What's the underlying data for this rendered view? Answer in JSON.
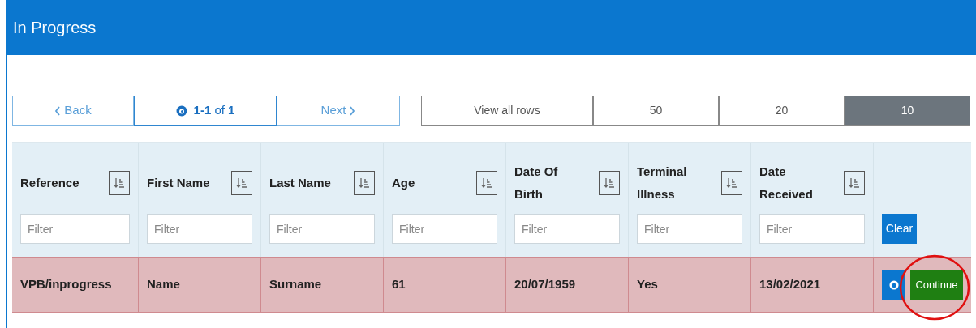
{
  "header": {
    "title": "In Progress"
  },
  "pager": {
    "back": "Back",
    "range": "**1-1** of **1**",
    "next": "Next"
  },
  "page_sizes": [
    {
      "label": "View all rows",
      "selected": false
    },
    {
      "label": "50",
      "selected": false
    },
    {
      "label": "20",
      "selected": false
    },
    {
      "label": "10",
      "selected": true
    }
  ],
  "table": {
    "columns": [
      {
        "label": "Reference",
        "placeholder": "Filter"
      },
      {
        "label": "First Name",
        "placeholder": "Filter"
      },
      {
        "label": "Last Name",
        "placeholder": "Filter"
      },
      {
        "label": "Age",
        "placeholder": "Filter"
      },
      {
        "label": "Date Of Birth",
        "placeholder": "Filter"
      },
      {
        "label": "Terminal Illness",
        "placeholder": "Filter"
      },
      {
        "label": "Date Received",
        "placeholder": "Filter"
      }
    ],
    "clear_button": "Clear",
    "rows": [
      {
        "cells": [
          "VPB/inprogress",
          "Name",
          "Surname",
          "61",
          "20/07/1959",
          "Yes",
          "13/02/2021"
        ],
        "action": "Continue"
      }
    ]
  }
}
